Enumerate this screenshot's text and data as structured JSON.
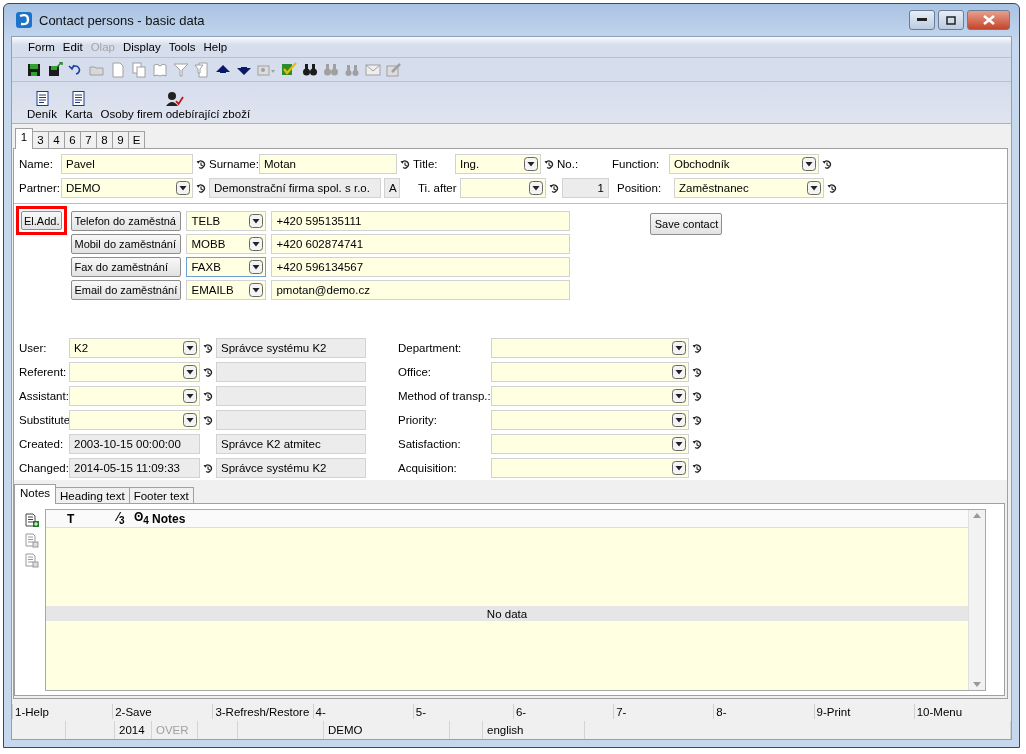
{
  "window": {
    "title": "Contact persons - basic data"
  },
  "menu": [
    {
      "label": "Form",
      "disabled": false
    },
    {
      "label": "Edit",
      "disabled": false
    },
    {
      "label": "Olap",
      "disabled": true
    },
    {
      "label": "Display",
      "disabled": false
    },
    {
      "label": "Tools",
      "disabled": false
    },
    {
      "label": "Help",
      "disabled": false
    }
  ],
  "toolbar": [
    {
      "disabled": false
    },
    {
      "disabled": false
    },
    {
      "disabled": false
    },
    {
      "disabled": true
    },
    {
      "disabled": true
    },
    {
      "disabled": true
    },
    {
      "disabled": true
    },
    {
      "disabled": true
    },
    {
      "disabled": true
    },
    {
      "disabled": false
    },
    {
      "disabled": false
    },
    {
      "disabled": true
    },
    {
      "disabled": false
    },
    {
      "disabled": false
    },
    {
      "disabled": true
    },
    {
      "disabled": true
    },
    {
      "disabled": true
    },
    {
      "disabled": true
    }
  ],
  "actions": [
    {
      "label": "Deník"
    },
    {
      "label": "Karta"
    },
    {
      "label": "Osoby firem odebírající zboží"
    }
  ],
  "tabs": [
    {
      "label": "1",
      "selected": true
    },
    {
      "label": "3",
      "selected": false
    },
    {
      "label": "4",
      "selected": false
    },
    {
      "label": "6",
      "selected": false
    },
    {
      "label": "7",
      "selected": false
    },
    {
      "label": "8",
      "selected": false
    },
    {
      "label": "9",
      "selected": false
    },
    {
      "label": "E",
      "selected": false
    }
  ],
  "header": {
    "name": {
      "label": "Name:",
      "value": "Pavel"
    },
    "surname": {
      "label": "Surname:",
      "value": "Motan"
    },
    "title": {
      "label": "Title:",
      "value": "Ing."
    },
    "number": {
      "label": "No.:",
      "value": "1"
    },
    "function": {
      "label": "Function:",
      "value": "Obchodník"
    },
    "partner": {
      "label": "Partner:",
      "value": "DEMO",
      "company": "Demonstrační firma spol. s r.o.",
      "flag": "A"
    },
    "title_after": {
      "label": "Ti. after"
    },
    "position": {
      "label": "Position:",
      "value": "Zaměstnanec"
    }
  },
  "contacts": {
    "add_button": {
      "label": "El.Add.",
      "highlighted": true
    },
    "save_button": "Save contact",
    "rows": [
      {
        "type": "Telefon do zaměstná",
        "code": "TELB",
        "value": "+420 595135111",
        "focused": false
      },
      {
        "type": "Mobil do zaměstnání",
        "code": "MOBB",
        "value": "+420 602874741",
        "focused": false
      },
      {
        "type": "Fax do zaměstnání",
        "code": "FAXB",
        "value": "+420 596134567",
        "focused": true
      },
      {
        "type": "Email do zaměstnání",
        "code": "EMAILB",
        "value": "pmotan@demo.cz",
        "focused": false
      }
    ]
  },
  "people": [
    {
      "kind": "combo",
      "label": "User:",
      "value": "K2",
      "name": "Správce systému K2",
      "history": true
    },
    {
      "kind": "combo",
      "label": "Referent:",
      "history": true
    },
    {
      "kind": "combo",
      "label": "Assistant:",
      "history": true
    },
    {
      "kind": "combo",
      "label": "Substitute",
      "history": true
    },
    {
      "kind": "readonly",
      "label": "Created:",
      "value": "2003-10-15 00:00:00",
      "name": "Správce K2 atmitec",
      "history": false
    },
    {
      "kind": "readonly",
      "label": "Changed:",
      "value": "2014-05-15 11:09:33",
      "name": "Správce systému K2",
      "history": true
    }
  ],
  "details": [
    {
      "label": "Department:"
    },
    {
      "label": "Office:"
    },
    {
      "label": "Method of transp.:"
    },
    {
      "label": "Priority:"
    },
    {
      "label": "Satisfaction:"
    },
    {
      "label": "Acquisition:"
    }
  ],
  "notes": {
    "tabs": [
      {
        "label": "Notes",
        "selected": true
      },
      {
        "label": "Heading text",
        "selected": false
      },
      {
        "label": "Footer text",
        "selected": false
      }
    ],
    "side_buttons": [
      {
        "disabled": false
      },
      {
        "disabled": true
      },
      {
        "disabled": true
      }
    ],
    "columns": [
      "T",
      "⁄$_{3}$",
      "ʘ$_{4}$",
      "Notes"
    ],
    "empty": "No data"
  },
  "function_keys": [
    "1-Help",
    "2-Save",
    "3-Refresh/Restore",
    "4-",
    "5-",
    "6-",
    "7-",
    "8-",
    "9-Print",
    "10-Menu"
  ],
  "status": [
    {
      "text": "2014",
      "disabled": false
    },
    {
      "text": "OVER",
      "disabled": true
    },
    {
      "text": "DEMO",
      "disabled": false
    },
    {
      "text": "english",
      "disabled": false
    }
  ]
}
